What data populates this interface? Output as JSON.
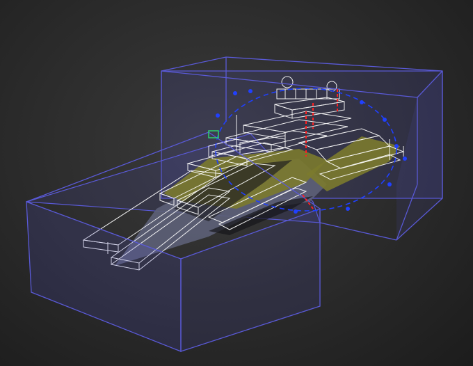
{
  "viewport": {
    "background_color": "#2b2b2b",
    "collision_box_color": "#5050c8",
    "wireframe_color": "#ffffff",
    "hull_top_color": "#7a7a30",
    "hull_bottom_color": "#6a6e8a",
    "rotation_gizmo_color": "#2040ff",
    "rotation_handle_color": "#ff2020",
    "pivot_color": "#30d070"
  },
  "objects": [
    {
      "name": "ship-model",
      "kind": "wireframe-mesh"
    },
    {
      "name": "bounding-box-rear",
      "kind": "collision-box"
    },
    {
      "name": "bounding-box-front",
      "kind": "collision-box"
    },
    {
      "name": "rotation-gizmo",
      "kind": "transform-handle"
    }
  ]
}
